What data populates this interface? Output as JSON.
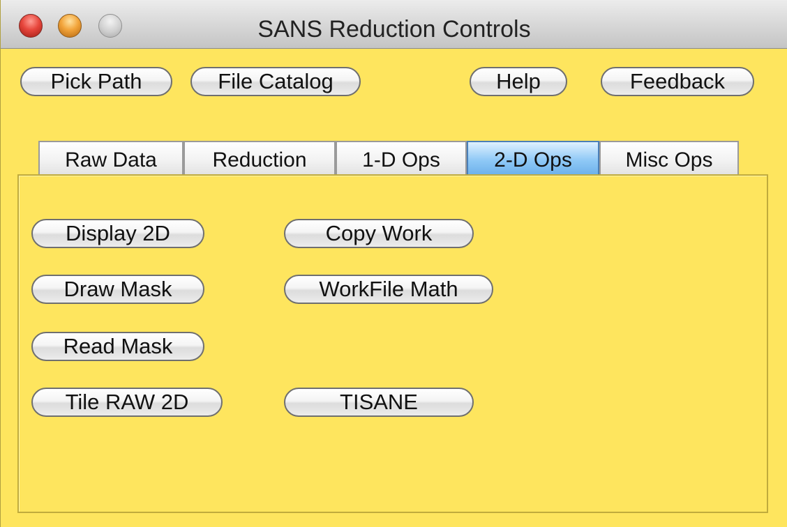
{
  "window": {
    "title": "SANS Reduction Controls"
  },
  "toolbar": {
    "pick_path": "Pick Path",
    "file_catalog": "File Catalog",
    "help": "Help",
    "feedback": "Feedback"
  },
  "tabs": [
    {
      "label": "Raw Data",
      "active": false
    },
    {
      "label": "Reduction",
      "active": false
    },
    {
      "label": "1-D Ops",
      "active": false
    },
    {
      "label": "2-D Ops",
      "active": true
    },
    {
      "label": "Misc Ops",
      "active": false
    }
  ],
  "panel": {
    "display_2d": "Display 2D",
    "copy_work": "Copy Work",
    "draw_mask": "Draw Mask",
    "workfile_math": "WorkFile Math",
    "read_mask": "Read Mask",
    "tile_raw_2d": "Tile RAW 2D",
    "tisane": "TISANE"
  },
  "colors": {
    "background": "#fee55e",
    "active_tab": "#8ec8f6"
  }
}
